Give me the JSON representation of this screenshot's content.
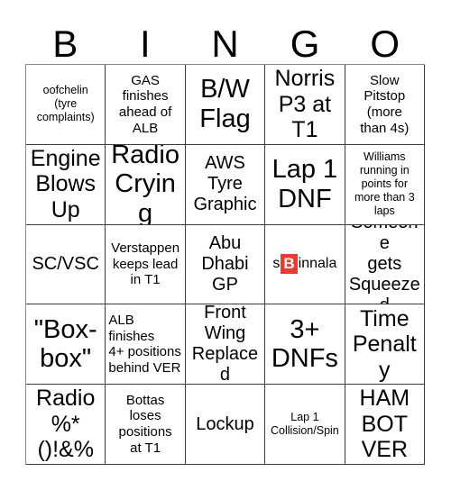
{
  "card": {
    "headers": [
      "B",
      "I",
      "N",
      "G",
      "O"
    ],
    "accent_color": "#ef3b2d",
    "grid_line_color": "#3c3c3c",
    "background_color": "#ffffff",
    "rows": [
      [
        {
          "text": "oofchelin\n(tyre\ncomplaints)",
          "size": "xs",
          "align": "center",
          "marked": false
        },
        {
          "text": "GAS\nfinishes\nahead of\nALB",
          "size": "sm",
          "align": "center",
          "marked": false
        },
        {
          "text": "B/W\nFlag",
          "size": "xl",
          "align": "center",
          "marked": false
        },
        {
          "text": "Norris\nP3 at\nT1",
          "size": "lg",
          "align": "center",
          "marked": false
        },
        {
          "text": "Slow\nPitstop\n(more\nthan 4s)",
          "size": "sm",
          "align": "center",
          "marked": false
        }
      ],
      [
        {
          "text": "Engine\nBlows\nUp",
          "size": "lg",
          "align": "center",
          "marked": false
        },
        {
          "text": "Radio\nCrying",
          "size": "xl",
          "align": "center",
          "marked": false
        },
        {
          "text": "AWS\nTyre\nGraphic",
          "size": "md",
          "align": "center",
          "marked": false
        },
        {
          "text": "Lap 1\nDNF",
          "size": "xl",
          "align": "center",
          "marked": false
        },
        {
          "text": "Williams\nrunning in\npoints for\nmore than 3\nlaps",
          "size": "xs",
          "align": "center",
          "marked": false
        }
      ],
      [
        {
          "text": "SC/VSC",
          "size": "md",
          "align": "center",
          "marked": false
        },
        {
          "text": "Verstappen\nkeeps lead\nin T1",
          "size": "sm",
          "align": "center",
          "marked": false
        },
        {
          "text": "Abu\nDhabi\nGP",
          "size": "md",
          "align": "center",
          "marked": false
        },
        {
          "text": "sBinnala",
          "size": "sm",
          "align": "center",
          "marked": true,
          "stamp": {
            "before": "s",
            "mark": "B",
            "after": "innala"
          }
        },
        {
          "text": "Someone\ngets\nSqueezed",
          "size": "md",
          "align": "center",
          "marked": false
        }
      ],
      [
        {
          "text": "\"Box-\nbox\"",
          "size": "xl",
          "align": "center",
          "marked": false
        },
        {
          "text": "ALB finishes\n4+ positions\nbehind VER",
          "size": "sm",
          "align": "left",
          "marked": false
        },
        {
          "text": "Front\nWing\nReplaced",
          "size": "md",
          "align": "center",
          "marked": false
        },
        {
          "text": "3+\nDNFs",
          "size": "xl",
          "align": "center",
          "marked": false
        },
        {
          "text": "Time\nPenalty",
          "size": "lg",
          "align": "center",
          "marked": false
        }
      ],
      [
        {
          "text": "Radio\n%*\n()!&%",
          "size": "lg",
          "align": "center",
          "marked": false
        },
        {
          "text": "Bottas\nloses\npositions\nat T1",
          "size": "sm",
          "align": "center",
          "marked": false
        },
        {
          "text": "Lockup",
          "size": "md",
          "align": "center",
          "marked": false
        },
        {
          "text": "Lap 1\nCollision/Spin",
          "size": "xs",
          "align": "center",
          "marked": false
        },
        {
          "text": "HAM\nBOT\nVER",
          "size": "lg",
          "align": "center",
          "marked": false
        }
      ]
    ]
  }
}
